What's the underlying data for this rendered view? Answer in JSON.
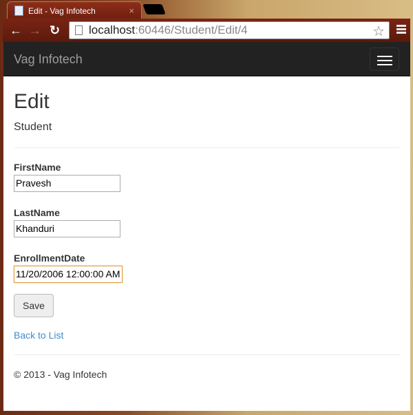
{
  "browser": {
    "tab_title": "Edit - Vag Infotech",
    "tab_close": "×",
    "url_host": "localhost",
    "url_rest": ":60446/Student/Edit/4"
  },
  "navbar": {
    "brand": "Vag Infotech"
  },
  "page": {
    "title": "Edit",
    "subtitle": "Student"
  },
  "form": {
    "fields": [
      {
        "label": "FirstName",
        "value": "Pravesh"
      },
      {
        "label": "LastName",
        "value": "Khanduri"
      },
      {
        "label": "EnrollmentDate",
        "value": "11/20/2006 12:00:00 AM"
      }
    ],
    "save_label": "Save"
  },
  "back_link": "Back to List",
  "footer": "© 2013 - Vag Infotech"
}
